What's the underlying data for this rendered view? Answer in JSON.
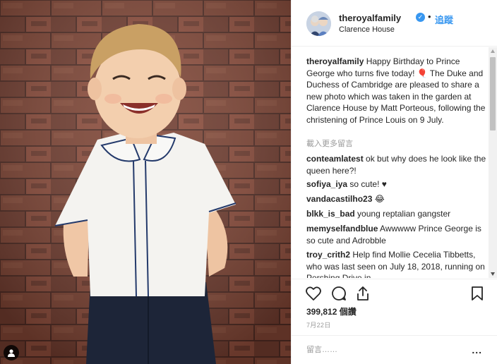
{
  "header": {
    "username": "theroyalfamily",
    "verified_icon": "verified-check-icon",
    "separator": "•",
    "follow_label": "追蹤",
    "location": "Clarence House"
  },
  "caption": {
    "username": "theroyalfamily",
    "text": "Happy Birthday to Prince George who turns five today! 🎈 The Duke and Duchess of Cambridge are pleased to share a new photo which was taken in the garden at Clarence House by Matt Porteous, following the christening of Prince Louis on 9 July."
  },
  "load_more_label": "載入更多留言",
  "comments": [
    {
      "username": "conteamlatest",
      "text": "ok but why does he look like the queen here?!"
    },
    {
      "username": "sofiya_iya",
      "text": "so cute! ♥"
    },
    {
      "username": "vandacastilho23",
      "text": "😂"
    },
    {
      "username": "blkk_is_bad",
      "text": "young reptalian gangster"
    },
    {
      "username": "memyselfandblue",
      "text": "Awwwww Prince George is so cute and Adrobble"
    },
    {
      "username": "troy_crith2",
      "text": "Help find Mollie Cecelia Tibbetts, who was last seen on July 18, 2018, running on Pershing Drive in"
    }
  ],
  "actions": {
    "like_icon": "heart-icon",
    "comment_icon": "comment-icon",
    "share_icon": "share-icon",
    "save_icon": "bookmark-icon"
  },
  "likes_count": "399,812",
  "likes_label": "個讚",
  "date": "7月22日",
  "add_comment": {
    "placeholder": "留言……",
    "more_label": "..."
  },
  "colors": {
    "link_blue": "#3897f0",
    "text": "#262626",
    "muted": "#999999",
    "border": "#efefef"
  }
}
